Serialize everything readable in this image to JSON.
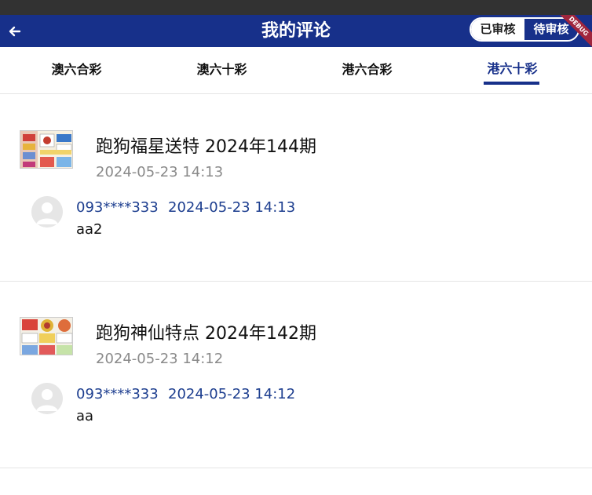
{
  "header": {
    "title": "我的评论",
    "back_icon": "arrow-left-icon",
    "toggle": {
      "approved_label": "已审核",
      "pending_label": "待审核",
      "selected": "approved"
    },
    "debug_label": "DEBUG",
    "colors": {
      "primary": "#17308a",
      "link": "#1d3e8f",
      "status_bar": "#323232"
    }
  },
  "tabs": [
    {
      "label": "澳六合彩"
    },
    {
      "label": "澳六十彩"
    },
    {
      "label": "港六合彩"
    },
    {
      "label": "港六十彩",
      "active": true
    }
  ],
  "comments": [
    {
      "post_title": "跑狗福星送特 2024年144期",
      "post_time": "2024-05-23 14:13",
      "user": "093****333",
      "comment_time": "2024-05-23 14:13",
      "text": "aa2"
    },
    {
      "post_title": "跑狗神仙特点 2024年142期",
      "post_time": "2024-05-23 14:12",
      "user": "093****333",
      "comment_time": "2024-05-23 14:12",
      "text": "aa"
    }
  ]
}
